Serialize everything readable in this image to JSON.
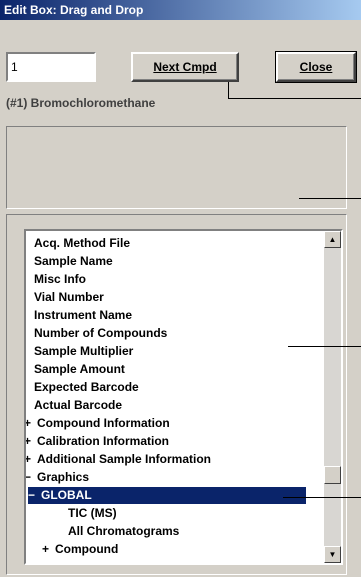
{
  "window": {
    "title": "Edit Box: Drag and Drop"
  },
  "toolbar": {
    "compound_number_value": "1",
    "next_label": "Next Cmpd",
    "close_label": "Close"
  },
  "compound": {
    "label": "(#1)  Bromochloromethane"
  },
  "tree": {
    "items": [
      {
        "pm": "",
        "label": "Acq. Method File"
      },
      {
        "pm": "",
        "label": "Sample Name"
      },
      {
        "pm": "",
        "label": "Misc Info"
      },
      {
        "pm": "",
        "label": "Vial Number"
      },
      {
        "pm": "",
        "label": "Instrument Name"
      },
      {
        "pm": "",
        "label": "Number of Compounds"
      },
      {
        "pm": "",
        "label": "Sample Multiplier"
      },
      {
        "pm": "",
        "label": "Sample Amount"
      },
      {
        "pm": "",
        "label": "Expected Barcode"
      },
      {
        "pm": "",
        "label": "Actual Barcode"
      },
      {
        "pm": "+",
        "label": "Compound Information"
      },
      {
        "pm": "+",
        "label": "Calibration Information"
      },
      {
        "pm": "+",
        "label": "Additional Sample Information"
      },
      {
        "pm": "−",
        "label": "Graphics"
      },
      {
        "pm": "−",
        "label": "GLOBAL",
        "selected": true
      },
      {
        "pm": "",
        "label": "TIC (MS)"
      },
      {
        "pm": "",
        "label": "All Chromatograms"
      },
      {
        "pm": "+",
        "label": "Compound"
      }
    ]
  },
  "scrollbar": {
    "up_icon": "arrow-up-icon",
    "down_icon": "arrow-down-icon"
  }
}
